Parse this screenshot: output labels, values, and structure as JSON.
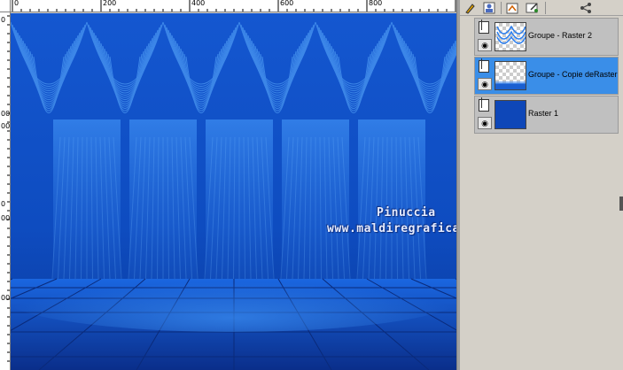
{
  "ruler": {
    "top_labels": [
      "0",
      "200",
      "400",
      "600",
      "800"
    ],
    "left_labels": [
      "0",
      "00",
      "00",
      "0",
      "00",
      "00"
    ]
  },
  "canvas": {
    "watermark_line1": "Pinuccia",
    "watermark_line2": "www.maldiregrafica.eu",
    "colors": {
      "background": "#0d4fc4",
      "light": "#3a8cf0",
      "dark": "#0a2e8a"
    }
  },
  "toolbar": {
    "icons": [
      "brush-icon",
      "person-icon",
      "layer-properties-icon",
      "edit-icon",
      "share-icon"
    ]
  },
  "layers": [
    {
      "name": "Groupe - Raster 2",
      "selected": false,
      "thumb": "pattern"
    },
    {
      "name": "Groupe - Copie deRaster",
      "selected": true,
      "thumb": "transparent"
    },
    {
      "name": "Raster 1",
      "selected": false,
      "thumb": "blue"
    }
  ]
}
